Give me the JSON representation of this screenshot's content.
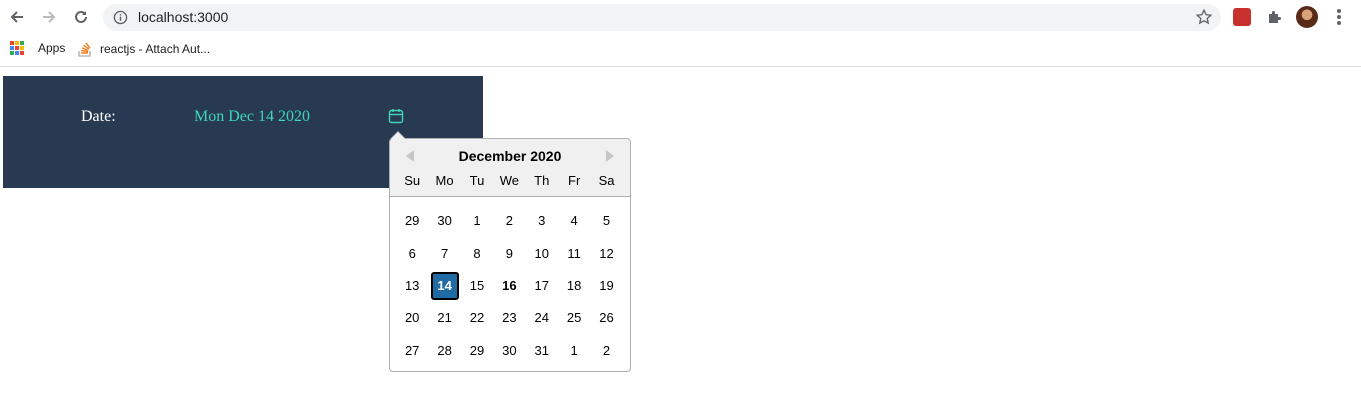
{
  "browser": {
    "url": "localhost:3000",
    "bookmarks": [
      {
        "label": "Apps",
        "icon": "apps-grid-icon"
      },
      {
        "label": "reactjs - Attach Aut...",
        "icon": "stackoverflow-icon"
      }
    ]
  },
  "form": {
    "date_label": "Date:",
    "date_value": "Mon Dec 14 2020",
    "accent_color": "#3fd6b7",
    "panel_color": "#283a52"
  },
  "calendar": {
    "month_title": "December 2020",
    "weekdays": [
      "Su",
      "Mo",
      "Tu",
      "We",
      "Th",
      "Fr",
      "Sa"
    ],
    "weeks": [
      [
        "29",
        "30",
        "1",
        "2",
        "3",
        "4",
        "5"
      ],
      [
        "6",
        "7",
        "8",
        "9",
        "10",
        "11",
        "12"
      ],
      [
        "13",
        "14",
        "15",
        "16",
        "17",
        "18",
        "19"
      ],
      [
        "20",
        "21",
        "22",
        "23",
        "24",
        "25",
        "26"
      ],
      [
        "27",
        "28",
        "29",
        "30",
        "31",
        "1",
        "2"
      ]
    ],
    "selected_day": "14",
    "today_day": "16",
    "selected_color": "#216ba5"
  }
}
